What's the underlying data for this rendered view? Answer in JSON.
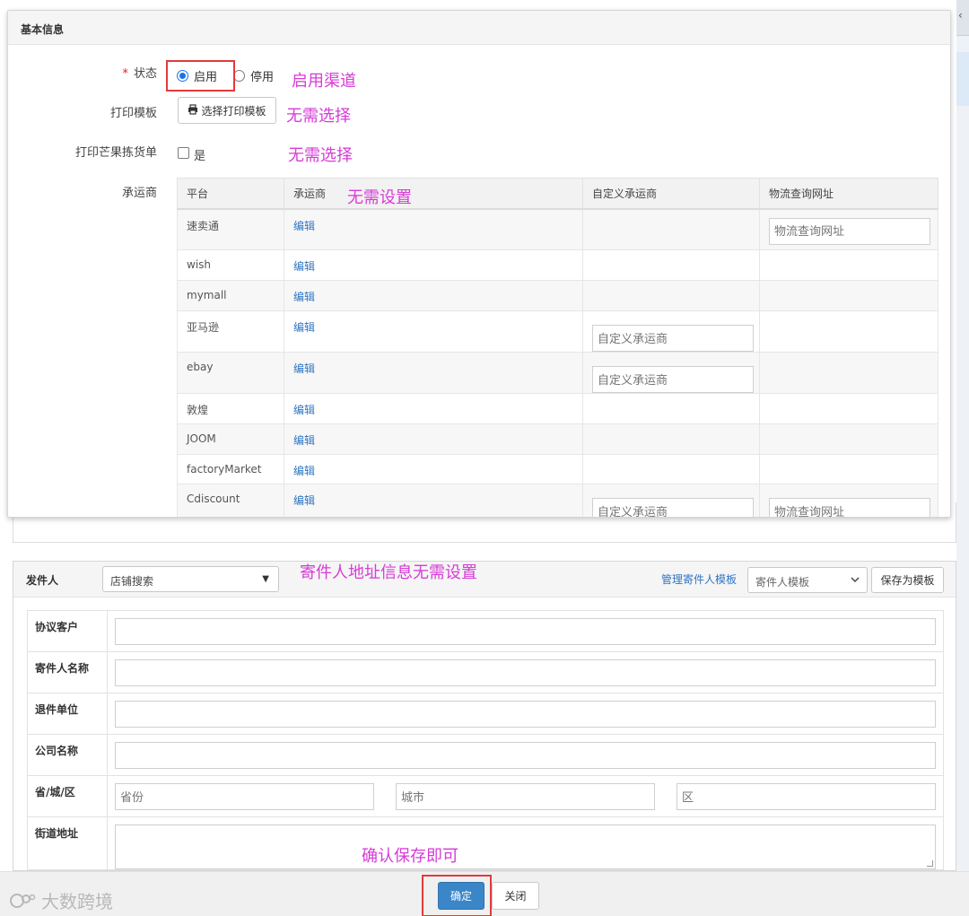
{
  "basic_info": {
    "title": "基本信息",
    "status": {
      "label": "状态",
      "required_mark": "*",
      "options": [
        "启用",
        "停用"
      ],
      "selected": "启用"
    },
    "print_template": {
      "label": "打印模板",
      "button_label": "选择打印模板"
    },
    "mango_picklist": {
      "label": "打印芒果拣货单",
      "checkbox_label": "是",
      "checked": false
    },
    "carrier": {
      "label": "承运商",
      "columns": [
        "平台",
        "承运商",
        "自定义承运商",
        "物流查询网址"
      ],
      "rows": [
        {
          "platform": "速卖通",
          "action": "编辑",
          "custom_placeholder": "",
          "url_placeholder": "物流查询网址"
        },
        {
          "platform": "wish",
          "action": "编辑",
          "custom_placeholder": "",
          "url_placeholder": ""
        },
        {
          "platform": "mymall",
          "action": "编辑",
          "custom_placeholder": "",
          "url_placeholder": ""
        },
        {
          "platform": "亚马逊",
          "action": "编辑",
          "custom_placeholder": "自定义承运商",
          "url_placeholder": ""
        },
        {
          "platform": "ebay",
          "action": "编辑",
          "custom_placeholder": "自定义承运商",
          "url_placeholder": ""
        },
        {
          "platform": "敦煌",
          "action": "编辑",
          "custom_placeholder": "",
          "url_placeholder": ""
        },
        {
          "platform": "JOOM",
          "action": "编辑",
          "custom_placeholder": "",
          "url_placeholder": ""
        },
        {
          "platform": "factoryMarket",
          "action": "编辑",
          "custom_placeholder": "",
          "url_placeholder": ""
        },
        {
          "platform": "Cdiscount",
          "action": "编辑",
          "custom_placeholder": "自定义承运商",
          "url_placeholder": "物流查询网址"
        }
      ]
    }
  },
  "annotations": {
    "enable_channel": "启用渠道",
    "no_select_1": "无需选择",
    "no_select_2": "无需选择",
    "no_setting": "无需设置",
    "sender_no_setting": "寄件人地址信息无需设置",
    "confirm_save": "确认保存即可"
  },
  "sender": {
    "title": "发件人",
    "shop_search": "店铺搜索",
    "manage_templates": "管理寄件人模板",
    "template_select": "寄件人模板",
    "save_as_template": "保存为模板",
    "fields": [
      {
        "label": "协议客户"
      },
      {
        "label": "寄件人名称"
      },
      {
        "label": "退件单位"
      },
      {
        "label": "公司名称"
      }
    ],
    "region": {
      "label": "省/城/区",
      "province": "省份",
      "city": "城市",
      "district": "区"
    },
    "street": {
      "label": "街道地址"
    }
  },
  "footer": {
    "confirm": "确定",
    "close": "关闭",
    "watermark": "大数跨境"
  },
  "colors": {
    "accent": "#3a86c8",
    "link": "#2f75c2",
    "annotation": "#d63bd6",
    "highlight": "#e33a3a"
  }
}
